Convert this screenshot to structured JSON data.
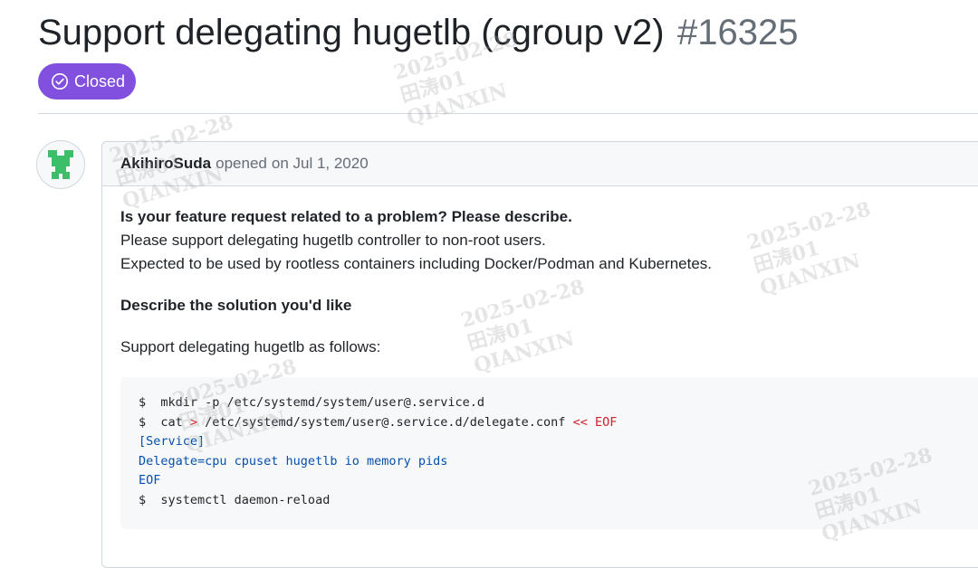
{
  "issue": {
    "title": "Support delegating hugetlb (cgroup v2)",
    "number": "#16325",
    "state": "Closed",
    "state_color": "#8250df"
  },
  "comment": {
    "author": "AkihiroSuda",
    "action": "opened",
    "date": "on Jul 1, 2020",
    "heading1": "Is your feature request related to a problem? Please describe.",
    "line1": "Please support delegating hugetlb controller to non-root users.",
    "line2": "Expected to be used by rootless containers including Docker/Podman and Kubernetes.",
    "heading2": "Describe the solution you'd like",
    "line3": "Support delegating hugetlb as follows:",
    "code": {
      "l1": "$  mkdir -p /etc/systemd/system/user@.service.d",
      "l2_prefix": "$  cat ",
      "l2_redirect": ">",
      "l2_path": " /etc/systemd/system/user@.service.d/delegate.conf ",
      "l2_heredoc": "<< EOF",
      "l3": "[Service]",
      "l4": "Delegate=cpu cpuset hugetlb io memory pids",
      "l5": "EOF",
      "l6": "$  systemctl daemon-reload"
    }
  },
  "watermark": {
    "date": "2025-02-28",
    "name": "田涛01",
    "org": "QIANXIN"
  },
  "icons": [
    "check-circle-icon",
    "avatar-icon"
  ]
}
